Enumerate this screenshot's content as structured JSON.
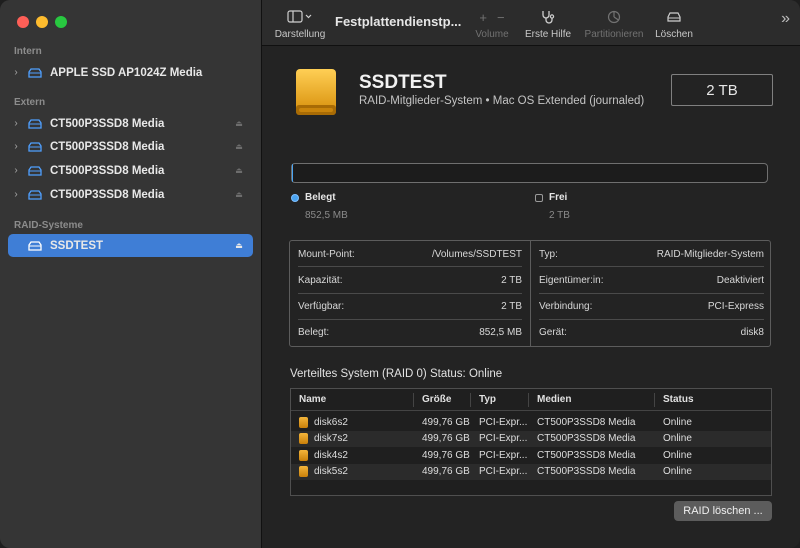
{
  "sidebar": {
    "sections": {
      "intern": "Intern",
      "extern": "Extern",
      "raid": "RAID-Systeme"
    },
    "items": [
      {
        "label": "APPLE SSD AP1024Z Media"
      },
      {
        "label": "CT500P3SSD8 Media"
      },
      {
        "label": "CT500P3SSD8 Media"
      },
      {
        "label": "CT500P3SSD8 Media"
      },
      {
        "label": "CT500P3SSD8 Media"
      },
      {
        "label": "SSDTEST"
      }
    ],
    "selected_index": 5
  },
  "toolbar": {
    "view_label": "Darstellung",
    "title": "Festplattendienstp...",
    "volume_label": "Volume",
    "first_aid_label": "Erste Hilfe",
    "partition_label": "Partitionieren",
    "erase_label": "Löschen"
  },
  "volume": {
    "name": "SSDTEST",
    "subtitle": "RAID-Mitglieder-System • Mac OS Extended (journaled)",
    "size": "2 TB"
  },
  "usage": {
    "used_label": "Belegt",
    "used_value": "852,5 MB",
    "free_label": "Frei",
    "free_value": "2 TB",
    "used_fraction": 0.0004,
    "used_color": "#4aa3f0"
  },
  "info": {
    "left": [
      {
        "key": "Mount-Point:",
        "value": "/Volumes/SSDTEST"
      },
      {
        "key": "Kapazität:",
        "value": "2 TB"
      },
      {
        "key": "Verfügbar:",
        "value": "2 TB"
      },
      {
        "key": "Belegt:",
        "value": "852,5 MB"
      }
    ],
    "right": [
      {
        "key": "Typ:",
        "value": "RAID-Mitglieder-System"
      },
      {
        "key": "Eigentümer:in:",
        "value": "Deaktiviert"
      },
      {
        "key": "Verbindung:",
        "value": "PCI-Express"
      },
      {
        "key": "Gerät:",
        "value": "disk8"
      }
    ]
  },
  "raid": {
    "title": "Verteiltes System (RAID 0) Status: Online",
    "columns": [
      "Name",
      "Größe",
      "Typ",
      "Medien",
      "Status"
    ],
    "rows": [
      [
        "disk6s2",
        "499,76 GB",
        "PCI-Expr...",
        "CT500P3SSD8 Media",
        "Online"
      ],
      [
        "disk7s2",
        "499,76 GB",
        "PCI-Expr...",
        "CT500P3SSD8 Media",
        "Online"
      ],
      [
        "disk4s2",
        "499,76 GB",
        "PCI-Expr...",
        "CT500P3SSD8 Media",
        "Online"
      ],
      [
        "disk5s2",
        "499,76 GB",
        "PCI-Expr...",
        "CT500P3SSD8 Media",
        "Online"
      ]
    ],
    "delete_button": "RAID löschen ..."
  },
  "colors": {
    "accent": "#3f7ed6",
    "disk_icon": "#f0a81f"
  }
}
